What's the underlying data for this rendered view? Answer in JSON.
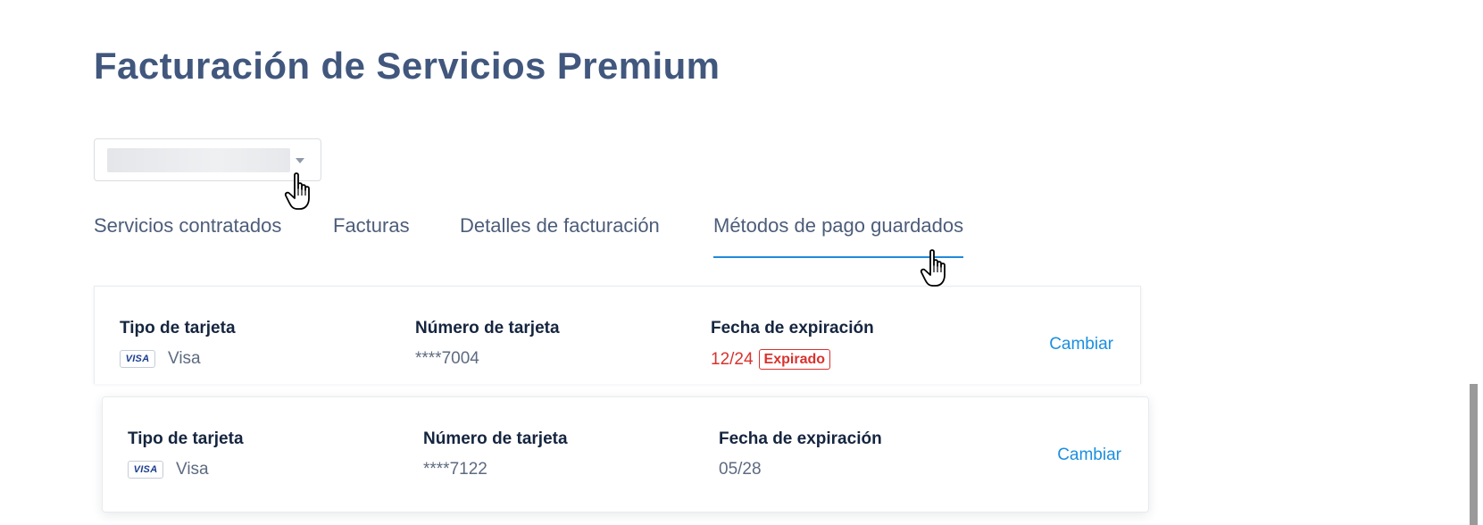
{
  "page": {
    "title": "Facturación de Servicios Premium"
  },
  "tabs": [
    {
      "label": "Servicios contratados",
      "active": false
    },
    {
      "label": "Facturas",
      "active": false
    },
    {
      "label": "Detalles de facturación",
      "active": false
    },
    {
      "label": "Métodos de pago guardados",
      "active": true
    }
  ],
  "cards": [
    {
      "card_type_label": "Tipo de tarjeta",
      "card_brand_badge": "VISA",
      "card_brand": "Visa",
      "card_number_label": "Número de tarjeta",
      "card_number": "****7004",
      "expiry_label": "Fecha de expiración",
      "expiry_date": "12/24",
      "status_badge": "Expirado",
      "action_label": "Cambiar"
    },
    {
      "card_type_label": "Tipo de tarjeta",
      "card_brand_badge": "VISA",
      "card_brand": "Visa",
      "card_number_label": "Número de tarjeta",
      "card_number": "****7122",
      "expiry_label": "Fecha de expiración",
      "expiry_date": "05/28",
      "action_label": "Cambiar"
    }
  ],
  "colors": {
    "title": "#41577d",
    "tab_text": "#4c5d7a",
    "tab_active_underline": "#1f8bdb",
    "link": "#1a8fe0",
    "expired": "#d9322e",
    "label": "#15253f"
  },
  "icons": {
    "select_caret": "caret-down-icon",
    "cursor": "hand-pointer-icon"
  }
}
